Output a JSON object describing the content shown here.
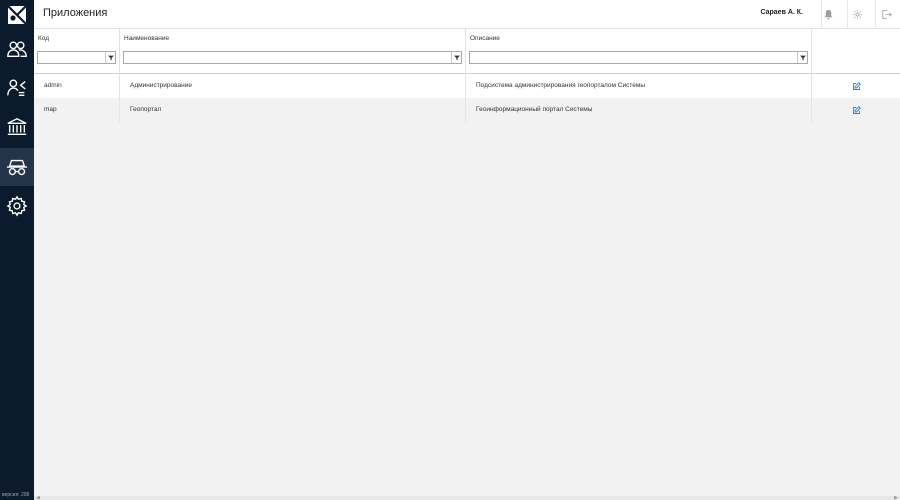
{
  "header": {
    "title": "Приложения",
    "user": "Сараев А. К."
  },
  "sidebar": {
    "version": "версия: 208",
    "items": [
      {
        "icon": "users-icon"
      },
      {
        "icon": "user-assign-icon"
      },
      {
        "icon": "bank-icon"
      },
      {
        "icon": "spy-icon",
        "active": true
      },
      {
        "icon": "gear-icon"
      }
    ]
  },
  "filters": {
    "columns": [
      {
        "label": "Код",
        "value": ""
      },
      {
        "label": "Наименование",
        "value": ""
      },
      {
        "label": "Описание",
        "value": ""
      }
    ]
  },
  "table": {
    "rows": [
      {
        "code": "admin",
        "name": "Администрирование",
        "description": "Подсистема администрирования геопорталом Системы"
      },
      {
        "code": "map",
        "name": "Геопортал",
        "description": "Геоинформационный портал Системы"
      }
    ]
  },
  "colors": {
    "sidebar_bg": "#0c1a2e",
    "sidebar_active": "#24344b",
    "edit_icon": "#1e88e5"
  }
}
